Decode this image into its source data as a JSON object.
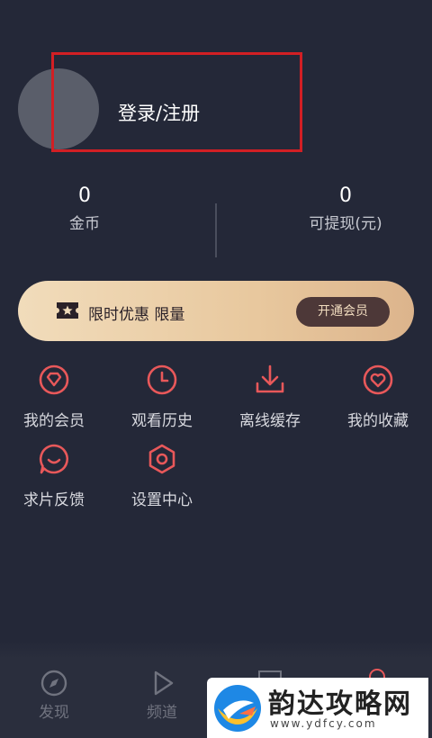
{
  "profile": {
    "login_label": "登录/注册"
  },
  "stats": {
    "coins": {
      "value": "0",
      "label": "金币"
    },
    "withdrawable": {
      "value": "0",
      "label": "可提现(元)"
    }
  },
  "vip_banner": {
    "text": "限时优惠 限量",
    "button_label": "开通会员"
  },
  "menu": [
    {
      "label": "我的会员",
      "icon": "vip-diamond-icon"
    },
    {
      "label": "观看历史",
      "icon": "clock-icon"
    },
    {
      "label": "离线缓存",
      "icon": "download-icon"
    },
    {
      "label": "我的收藏",
      "icon": "heart-icon"
    },
    {
      "label": "求片反馈",
      "icon": "feedback-chat-icon"
    },
    {
      "label": "设置中心",
      "icon": "settings-hexagon-icon"
    }
  ],
  "bottom_nav": [
    {
      "label": "发现",
      "icon": "compass-icon"
    },
    {
      "label": "频道",
      "icon": "play-icon"
    }
  ],
  "watermark": {
    "title": "韵达攻略网",
    "url": "www.ydfcy.com"
  },
  "colors": {
    "background": "#242838",
    "accent": "#e8585a",
    "banner_gold": "#e8c89e",
    "highlight_box": "#d21f24"
  }
}
